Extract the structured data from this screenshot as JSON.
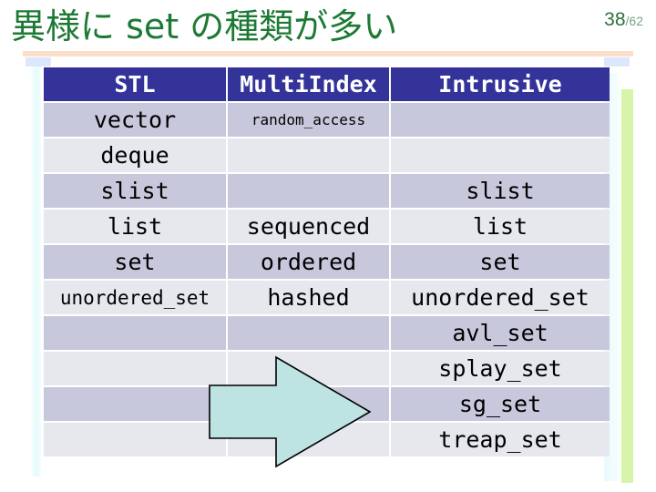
{
  "slide": {
    "title": "異様に set の種類が多い",
    "page_current": "38",
    "page_total": "/62",
    "title_color": "#1d7a34",
    "rule_color": "#fbdfc9"
  },
  "table": {
    "header_bg": "#333399",
    "header_fg": "#ffffff",
    "row_odd_bg": "#c8c8dc",
    "row_even_bg": "#e7e8ee",
    "columns": [
      "STL",
      "MultiIndex",
      "Intrusive"
    ],
    "rows": [
      {
        "stl": "vector",
        "multiindex": "random_access",
        "intrusive": ""
      },
      {
        "stl": "deque",
        "multiindex": "",
        "intrusive": ""
      },
      {
        "stl": "slist",
        "multiindex": "",
        "intrusive": "slist"
      },
      {
        "stl": "list",
        "multiindex": "sequenced",
        "intrusive": "list"
      },
      {
        "stl": "set",
        "multiindex": "ordered",
        "intrusive": "set"
      },
      {
        "stl": "unordered_set",
        "multiindex": "hashed",
        "intrusive": "unordered_set"
      },
      {
        "stl": "",
        "multiindex": "",
        "intrusive": "avl_set"
      },
      {
        "stl": "",
        "multiindex": "",
        "intrusive": "splay_set"
      },
      {
        "stl": "",
        "multiindex": "",
        "intrusive": "sg_set"
      },
      {
        "stl": "",
        "multiindex": "",
        "intrusive": "treap_set"
      }
    ]
  },
  "arrow": {
    "label": "right-arrow",
    "fill": "#bde3e3",
    "stroke": "#000000"
  },
  "decor": {
    "left_glow": "#e6fbfb",
    "right_glow": "#e8fafc",
    "right_green": "#d6f5a9",
    "top_tab": "#dde7fb"
  }
}
